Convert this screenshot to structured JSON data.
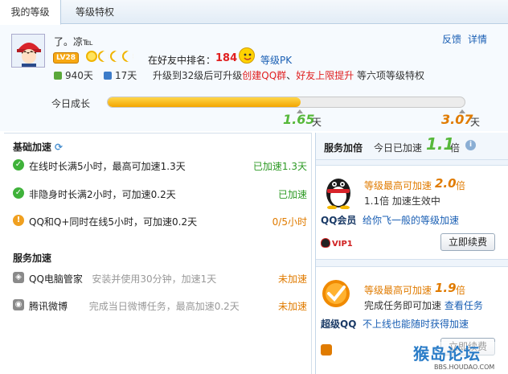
{
  "tabs": [
    {
      "label": "我的等级",
      "active": true
    },
    {
      "label": "等级特权",
      "active": false
    }
  ],
  "profile": {
    "nickname": "了。凉℡",
    "level_badge": "LV28",
    "rank_label": "在好友中排名：",
    "rank_value": "184",
    "pk_link": "等级PK",
    "feedback_link": "反馈",
    "detail_link": "详情",
    "days_total": "940天",
    "days_left": "17天",
    "upgrade_prefix": "升级到32级后可升级",
    "upgrade_red1": "创建QQ群",
    "upgrade_red2": "好友上限提升",
    "upgrade_suffix": "等六项等级特权"
  },
  "today": {
    "label": "今日成长",
    "progress": 0.54,
    "current_value": "1.65",
    "max_value": "3.07",
    "unit": "天"
  },
  "basic": {
    "title": "基础加速",
    "rows": [
      {
        "icon": "check",
        "text": "在线时长满5小时，最高可加速1.3天",
        "status": "已加速1.3天",
        "status_color": "green"
      },
      {
        "icon": "check",
        "text": "非隐身时长满2小时，可加速0.2天",
        "status": "已加速",
        "status_color": "green"
      },
      {
        "icon": "warn",
        "text": "QQ和Q+同时在线5小时，可加速0.2天",
        "status": "0/5小时",
        "status_color": "orange"
      }
    ]
  },
  "service": {
    "title": "服务加速",
    "rows": [
      {
        "name": "QQ电脑管家",
        "desc": "安装并使用30分钟，加速1天",
        "status": "未加速"
      },
      {
        "name": "腾讯微博",
        "desc": "完成当日微博任务，最高加速0.2天",
        "status": "未加速"
      }
    ]
  },
  "multiplier": {
    "title": "服务加倍",
    "today_label": "今日已加速",
    "today_value": "1.1",
    "today_unit": "倍",
    "info": "i"
  },
  "qq_member": {
    "label": "等级最高可加速",
    "value": "2.0",
    "unit": "倍",
    "line2": "1.1倍 加速生效中",
    "name": "QQ会员",
    "link": "给你飞一般的等级加速",
    "badge": "VIP1",
    "button": "立即续费"
  },
  "super_qq": {
    "label": "等级最高可加速",
    "value": "1.9",
    "unit": "倍",
    "line2": "完成任务即可加速",
    "task_link": "查看任务",
    "name": "超级QQ",
    "link": "不上线也能随时获得加速",
    "button": "立即续费"
  },
  "watermark": {
    "brand": "猴岛论坛",
    "url": "BBS.HOUDAO.COM"
  },
  "colors": {
    "accent_blue": "#1a5fb4",
    "red": "#e02020",
    "green": "#2d9a24",
    "orange": "#e07b00",
    "progress": "#f3a600"
  }
}
